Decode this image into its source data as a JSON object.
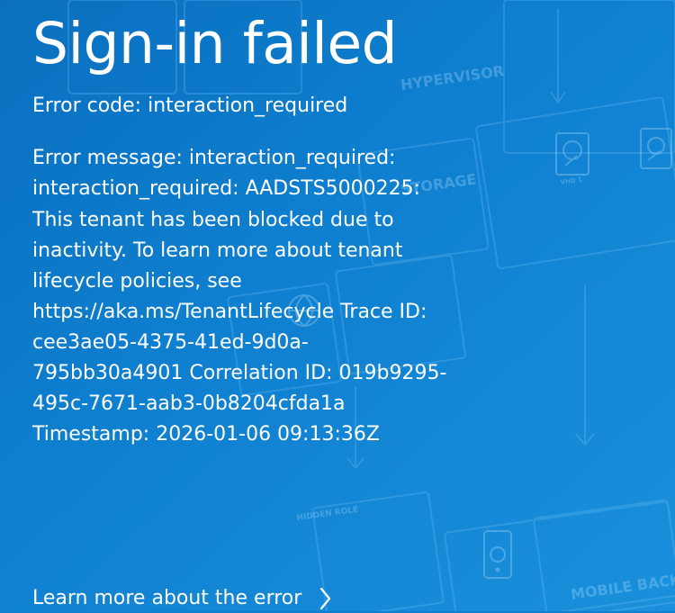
{
  "page": {
    "title": "Sign-in failed",
    "error_code": "Error code: interaction_required",
    "error_message": "Error message: interaction_required: interaction_required: AADSTS5000225: This tenant has been blocked due to inactivity. To learn more about tenant lifecycle policies, see https://aka.ms/TenantLifecycle Trace ID: cee3ae05-4375-41ed-9d0a-795bb30a4901 Correlation ID: 019b9295-495c-7671-aab3-0b8204cfda1a Timestamp: 2026-01-06 09:13:36Z",
    "learn_more_link": "Learn more about the error"
  },
  "background": {
    "watermark_labels": {
      "hypervisor": "HYPERVISOR",
      "storage": "STORAGE",
      "vhd_1": "VHD 1",
      "mobile_backend": "MOBILE BACKEND",
      "hidden_role": "HIDDEN ROLE"
    }
  },
  "icons": {
    "learn_more": "chevron-right-icon",
    "watermark_disk": "disk-icon",
    "watermark_globe": "globe-icon",
    "watermark_phone": "mobile-icon"
  },
  "colors": {
    "background": "#0f7fd0",
    "text": "#ffffff"
  }
}
